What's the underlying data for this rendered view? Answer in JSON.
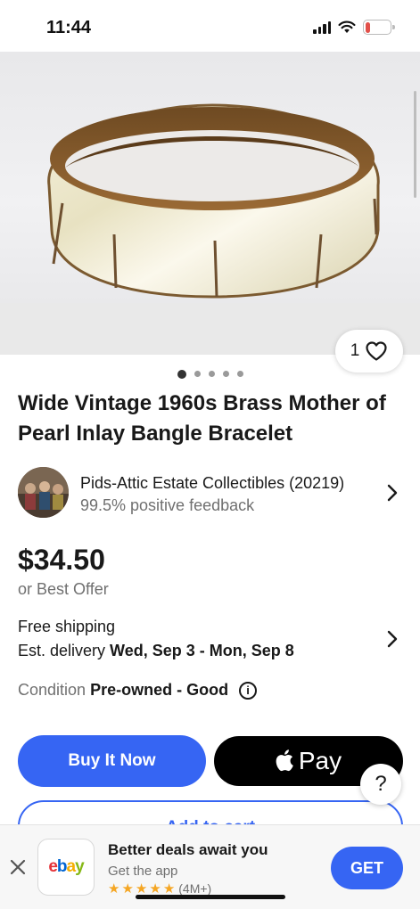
{
  "status_bar": {
    "time": "11:44",
    "battery": "17",
    "battery_level": 0.17
  },
  "gallery": {
    "watch_count": "1",
    "image_count": 5,
    "active_index": 0
  },
  "listing": {
    "title": "Wide Vintage 1960s Brass Mother of Pearl Inlay Bangle Bracelet",
    "seller_name": "Pids-Attic Estate Collectibles (20219)",
    "seller_feedback": "99.5% positive feedback",
    "price": "$34.50",
    "best_offer": "or Best Offer",
    "shipping": "Free shipping",
    "delivery_prefix": "Est. delivery ",
    "delivery_dates": "Wed, Sep 3 - Mon, Sep 8",
    "condition_label": "Condition",
    "condition_value": "Pre-owned - Good"
  },
  "actions": {
    "buy_now": "Buy It Now",
    "apple_pay": "Pay",
    "add_to_cart": "Add to cart",
    "help": "?"
  },
  "app_banner": {
    "logo": "ebay",
    "title": "Better deals await you",
    "subtitle": "Get the app",
    "rating_stars": 5,
    "rating_count": "(4M+)",
    "get": "GET"
  },
  "colors": {
    "accent": "#3665f3",
    "battery": "#e2504a",
    "star": "#f5a623"
  }
}
